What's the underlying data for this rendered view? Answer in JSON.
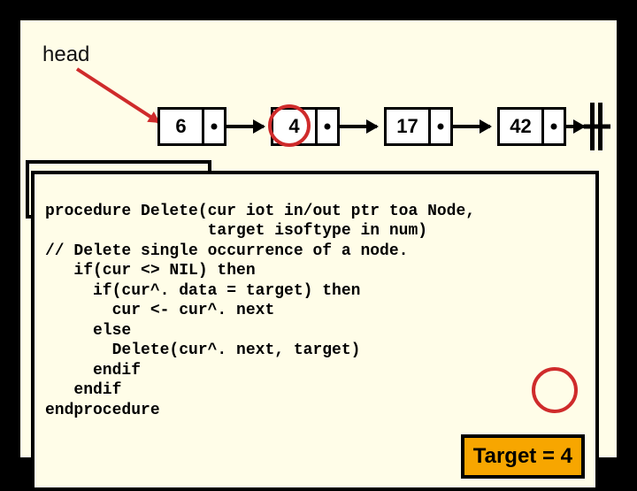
{
  "head_label": "head",
  "nodes": [
    "6",
    "4",
    "17",
    "42"
  ],
  "code": {
    "l1": "procedure Delete(cur iot in/out ptr toa Node,",
    "l2": "                 target isoftype in num)",
    "l3": "// Delete single occurrence of a node.",
    "l4": "   if(cur <> NIL) then",
    "l5": "     if(cur^. data = target) then",
    "l6": "       cur <- cur^. next",
    "l7": "     else",
    "l8": "       Delete(cur^. next, target)",
    "l9": "     endif",
    "l10": "   endif",
    "l11": "endprocedure"
  },
  "target_label": "Target = 4"
}
